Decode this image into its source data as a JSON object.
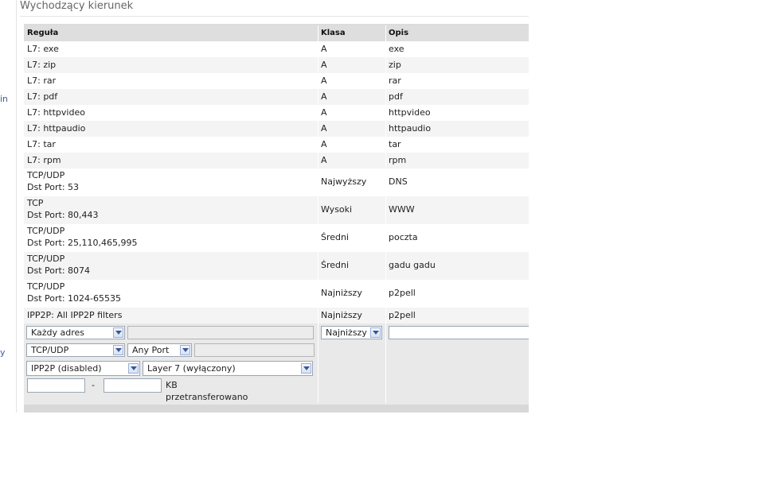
{
  "side_fragments": [
    "in",
    "y"
  ],
  "section": {
    "title": "Wychodzący kierunek"
  },
  "table": {
    "headers": {
      "rule": "Reguła",
      "class": "Klasa",
      "desc": "Opis"
    },
    "rows": [
      {
        "rule1": "L7: exe",
        "rule2": "",
        "cls": "A",
        "desc": "exe"
      },
      {
        "rule1": "L7: zip",
        "rule2": "",
        "cls": "A",
        "desc": "zip"
      },
      {
        "rule1": "L7: rar",
        "rule2": "",
        "cls": "A",
        "desc": "rar"
      },
      {
        "rule1": "L7: pdf",
        "rule2": "",
        "cls": "A",
        "desc": "pdf"
      },
      {
        "rule1": "L7: httpvideo",
        "rule2": "",
        "cls": "A",
        "desc": "httpvideo"
      },
      {
        "rule1": "L7: httpaudio",
        "rule2": "",
        "cls": "A",
        "desc": "httpaudio"
      },
      {
        "rule1": "L7: tar",
        "rule2": "",
        "cls": "A",
        "desc": "tar"
      },
      {
        "rule1": "L7: rpm",
        "rule2": "",
        "cls": "A",
        "desc": "rpm"
      },
      {
        "rule1": "TCP/UDP",
        "rule2": "Dst Port: 53",
        "cls": "Najwyższy",
        "desc": "DNS"
      },
      {
        "rule1": "TCP",
        "rule2": "Dst Port: 80,443",
        "cls": "Wysoki",
        "desc": "WWW"
      },
      {
        "rule1": "TCP/UDP",
        "rule2": "Dst Port: 25,110,465,995",
        "cls": "Średni",
        "desc": "poczta"
      },
      {
        "rule1": "TCP/UDP",
        "rule2": "Dst Port: 8074",
        "cls": "Średni",
        "desc": "gadu gadu"
      },
      {
        "rule1": "TCP/UDP",
        "rule2": "Dst Port: 1024-65535",
        "cls": "Najniższy",
        "desc": "p2pell"
      },
      {
        "rule1": "IPP2P: All IPP2P filters",
        "rule2": "",
        "cls": "Najniższy",
        "desc": "p2pell"
      }
    ]
  },
  "form": {
    "address_select": "Każdy adres",
    "address_input": "",
    "class_select": "Najniższy",
    "desc_input": "",
    "proto_select": "TCP/UDP",
    "port_select": "Any Port",
    "port_input": "",
    "ipp2p_select": "IPP2P (disabled)",
    "layer7_select": "Layer 7 (wyłączony)",
    "kb_from": "",
    "kb_dash": "-",
    "kb_to": "",
    "kb_label": "KB",
    "transferred_label": "przetransferowano"
  }
}
